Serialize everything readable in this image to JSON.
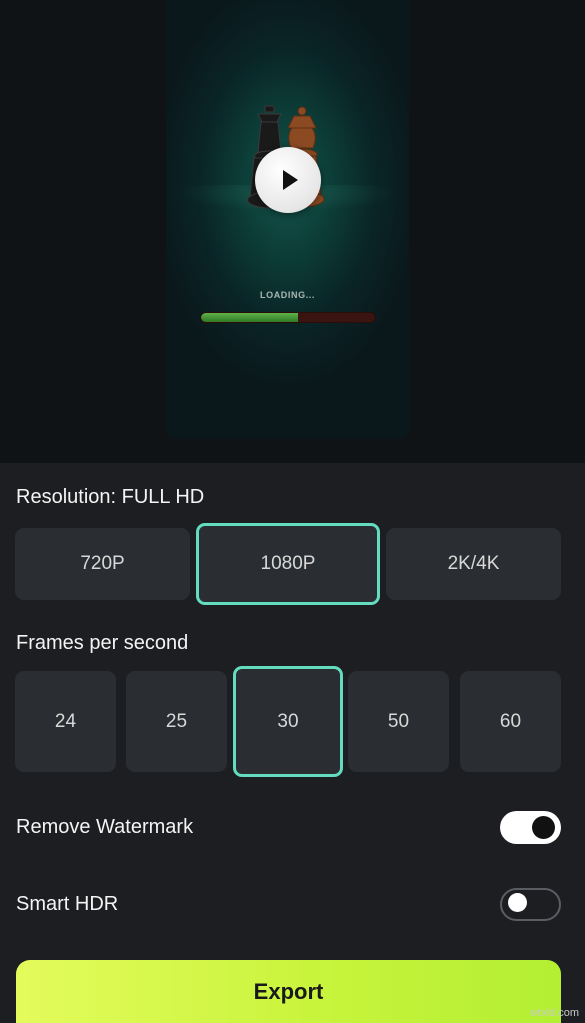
{
  "preview": {
    "loading_text": "LOADING...",
    "loading_progress": 0.56,
    "play_icon": "play-icon"
  },
  "resolution": {
    "label": "Resolution: FULL HD",
    "options": [
      "720P",
      "1080P",
      "2K/4K"
    ],
    "selected": "1080P"
  },
  "fps": {
    "label": "Frames per second",
    "options": [
      "24",
      "25",
      "30",
      "50",
      "60"
    ],
    "selected": "30"
  },
  "toggles": {
    "remove_watermark": {
      "label": "Remove Watermark",
      "on": true
    },
    "smart_hdr": {
      "label": "Smart HDR",
      "on": false
    }
  },
  "export_label": "Export",
  "watermark_text": "wtvid.com",
  "colors": {
    "accent_selection": "#63dcbf",
    "export_gradient_start": "#e4fb5c",
    "export_gradient_end": "#b3ef33",
    "panel_background": "#1c1e21"
  }
}
